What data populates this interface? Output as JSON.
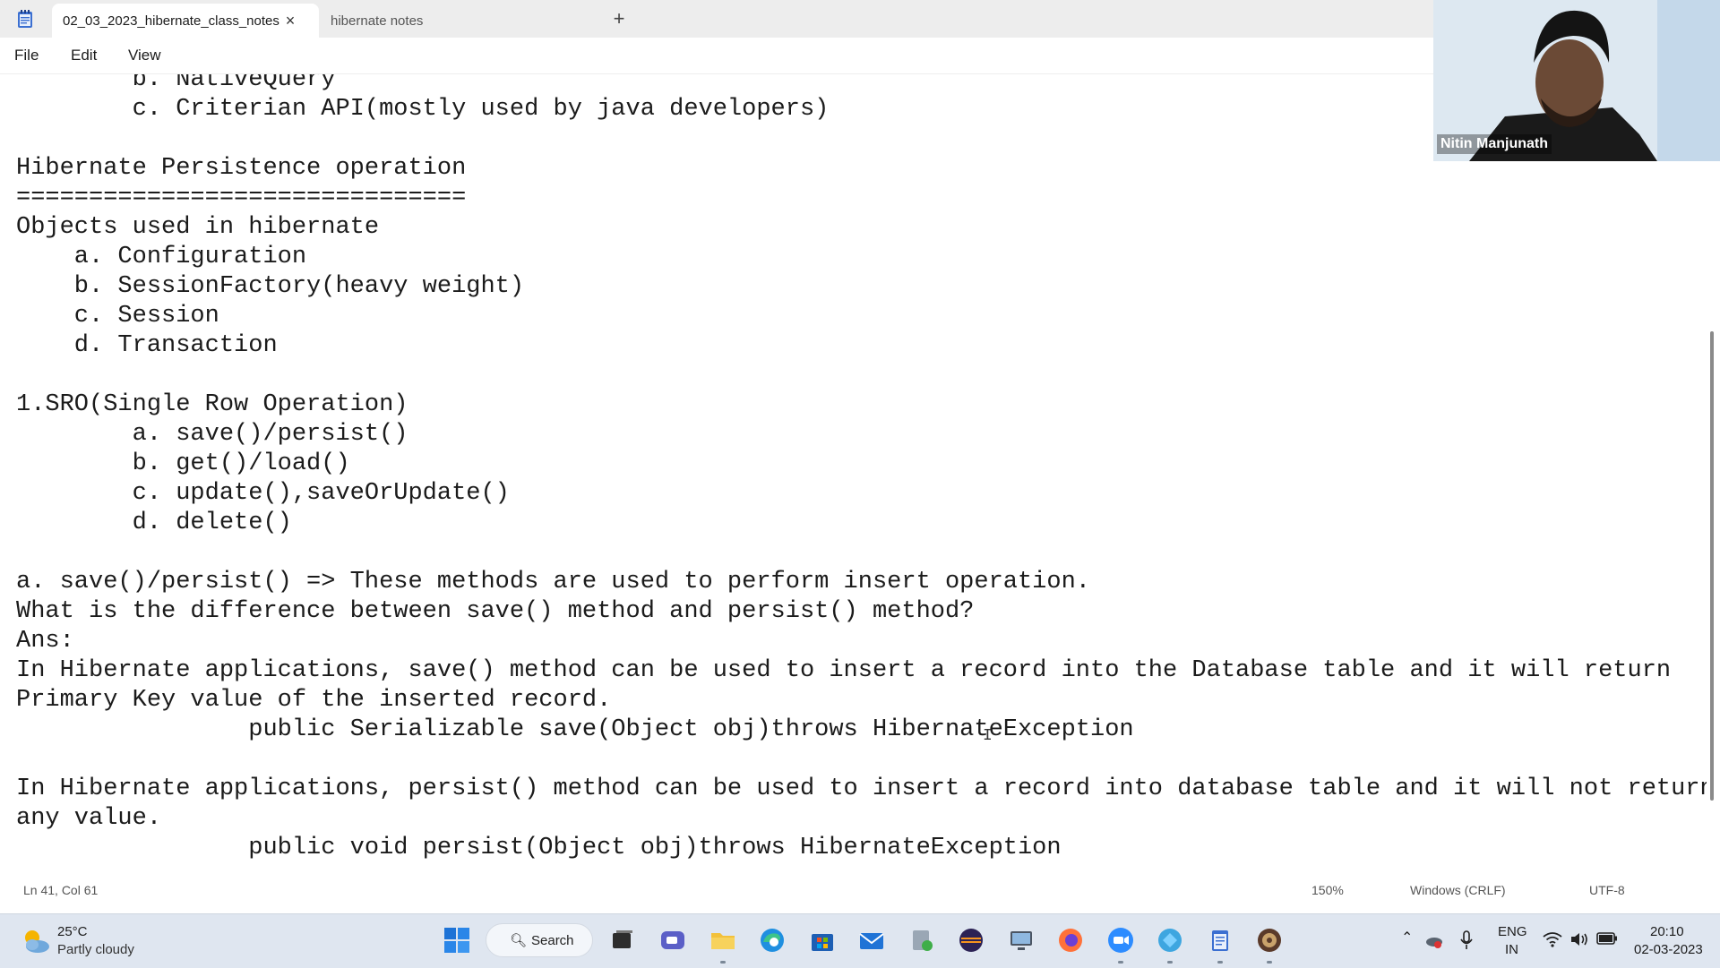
{
  "tabs": {
    "active_label": "02_03_2023_hibernate_class_notes",
    "inactive_label": "hibernate notes",
    "close_symbol": "×",
    "new_tab_symbol": "+"
  },
  "menu": {
    "file": "File",
    "edit": "Edit",
    "view": "View"
  },
  "editor": {
    "content": "        b. NativeQuery\n        c. Criterian API(mostly used by java developers)\n\nHibernate Persistence operation\n===============================\nObjects used in hibernate\n    a. Configuration\n    b. SessionFactory(heavy weight)\n    c. Session\n    d. Transaction\n\n1.SRO(Single Row Operation)\n        a. save()/persist()\n        b. get()/load()\n        c. update(),saveOrUpdate()\n        d. delete()\n\na. save()/persist() => These methods are used to perform insert operation.\nWhat is the difference between save() method and persist() method?\nAns:\nIn Hibernate applications, save() method can be used to insert a record into the Database table and it will return\nPrimary Key value of the inserted record.\n                public Serializable save(Object obj)throws HibernateException\n\nIn Hibernate applications, persist() method can be used to insert a record into database table and it will not return\nany value.\n                public void persist(Object obj)throws HibernateException"
  },
  "webcam": {
    "participant_name": "Nitin Manjunath"
  },
  "status": {
    "position": "Ln 41, Col 61",
    "zoom": "150%",
    "line_ending": "Windows (CRLF)",
    "encoding": "UTF-8"
  },
  "taskbar": {
    "weather_temp": "25°C",
    "weather_condition": "Partly cloudy",
    "search_label": "Search",
    "lang_line1": "ENG",
    "lang_line2": "IN",
    "time": "20:10",
    "date": "02-03-2023",
    "pinned_icons": [
      "windows-start-icon",
      "task-view-icon",
      "teams-chat-icon",
      "file-explorer-icon",
      "edge-icon",
      "store-icon",
      "mail-icon",
      "file-transfer-icon",
      "eclipse-icon",
      "remote-desktop-icon",
      "firefox-icon",
      "zoom-icon",
      "vpn-icon",
      "notepad-icon",
      "game-icon"
    ]
  },
  "colors": {
    "accent": "#0067c0",
    "taskbar_bg": "#dfe6f0",
    "tab_bar_bg": "#ededed"
  }
}
